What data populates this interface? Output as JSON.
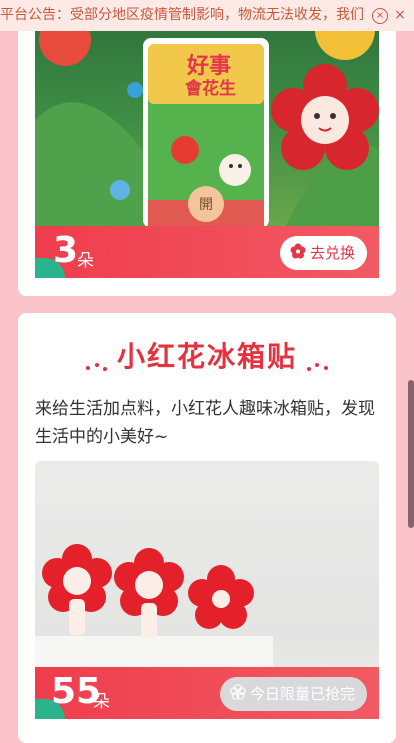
{
  "notice": {
    "text": "平台公告：受部分地区疫情管制影响，物流无法收发，我们",
    "close_icon": "close-icon"
  },
  "cards": [
    {
      "price_num": "3",
      "price_unit": "朵",
      "button_label": "去兑换",
      "button_icon": "flower-icon",
      "image_label_top": "好事",
      "image_label_mid": "會花生",
      "image_seal": "開"
    },
    {
      "title": "小红花冰箱贴",
      "description": "来给生活加点料，小红花人趣味冰箱贴，发现生活中的小美好~",
      "price_num": "55",
      "price_unit": "朵",
      "button_label": "今日限量已抢完",
      "button_icon": "flower-icon"
    }
  ],
  "colors": {
    "accent": "#e5323f",
    "bg": "#fbc4cb",
    "notice_text": "#c85a3c"
  }
}
